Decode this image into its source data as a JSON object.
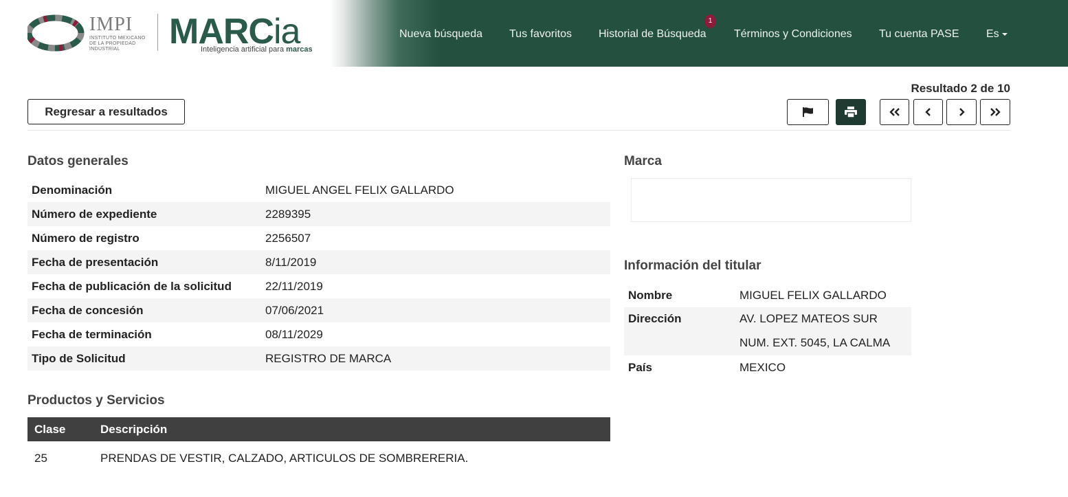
{
  "header": {
    "impi_word": "IMPI",
    "impi_sub": "INSTITUTO MEXICANO DE LA PROPIEDAD INDUSTRIAL",
    "marcia_main": "MARC",
    "marcia_ia": "ia",
    "marcia_tag_prefix": "Inteligencia artificial para ",
    "marcia_tag_bold": "marcas",
    "nav": {
      "nueva": "Nueva búsqueda",
      "favoritos": "Tus favoritos",
      "historial": "Historial de Búsqueda",
      "historial_badge": "1",
      "terminos": "Términos y Condiciones",
      "cuenta": "Tu cuenta PASE",
      "lang": "Es"
    },
    "colors": {
      "bar": "#24503f",
      "badge": "#8b1d3a",
      "brand": "#2a5a4b"
    }
  },
  "toolbar": {
    "result_count": "Resultado 2 de 10",
    "back_label": "Regresar a resultados",
    "icons": [
      "flag-icon",
      "print-icon",
      "first-page-icon",
      "prev-page-icon",
      "next-page-icon",
      "last-page-icon"
    ]
  },
  "datos": {
    "title": "Datos generales",
    "rows": [
      {
        "k": "Denominación",
        "v": "MIGUEL ANGEL FELIX GALLARDO"
      },
      {
        "k": "Número de expediente",
        "v": "2289395"
      },
      {
        "k": "Número de registro",
        "v": "2256507"
      },
      {
        "k": "Fecha de presentación",
        "v": "8/11/2019"
      },
      {
        "k": "Fecha de publicación de la solicitud",
        "v": "22/11/2019"
      },
      {
        "k": "Fecha de concesión",
        "v": "07/06/2021"
      },
      {
        "k": "Fecha de terminación",
        "v": "08/11/2029"
      },
      {
        "k": "Tipo de Solicitud",
        "v": "REGISTRO DE MARCA"
      }
    ]
  },
  "marca": {
    "title": "Marca"
  },
  "titular": {
    "title": "Información del titular",
    "nombre_k": "Nombre",
    "nombre_v": "MIGUEL FELIX GALLARDO",
    "direccion_k": "Dirección",
    "direccion_v1": "AV. LOPEZ MATEOS SUR",
    "direccion_v2": "NUM. EXT. 5045, LA CALMA",
    "pais_k": "País",
    "pais_v": "MEXICO"
  },
  "productos": {
    "title": "Productos y Servicios",
    "col_clase": "Clase",
    "col_desc": "Descripción",
    "rows": [
      {
        "clase": "25",
        "desc": "PRENDAS DE VESTIR, CALZADO, ARTICULOS DE SOMBRERERIA."
      }
    ]
  }
}
